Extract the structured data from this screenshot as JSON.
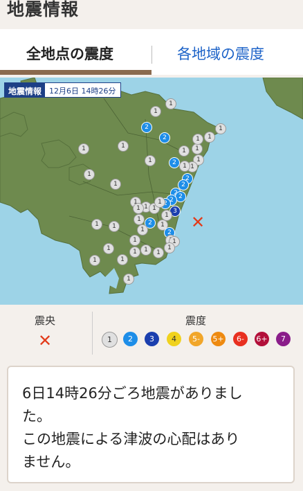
{
  "header": {
    "title": "地震情報"
  },
  "tabs": [
    {
      "label": "全地点の震度"
    },
    {
      "label": "各地域の震度"
    }
  ],
  "map": {
    "label_title": "地震情報",
    "label_time": "12月6日 14時26分"
  },
  "legend": {
    "epicenter_label": "震央",
    "epicenter_mark": "✕",
    "intensity_label": "震度",
    "scale": [
      {
        "label": "1",
        "color": "#e0e0e0"
      },
      {
        "label": "2",
        "color": "#1e8ee8"
      },
      {
        "label": "3",
        "color": "#1b3fae"
      },
      {
        "label": "4",
        "color": "#f0d21e"
      },
      {
        "label": "5-",
        "color": "#f1a62a"
      },
      {
        "label": "5+",
        "color": "#ee8a10"
      },
      {
        "label": "6-",
        "color": "#e83020"
      },
      {
        "label": "6+",
        "color": "#b2103a"
      },
      {
        "label": "7",
        "color": "#8a1d8a"
      }
    ]
  },
  "message": {
    "line1": "6日14時26分ごろ地震がありまし",
    "line2": "た。",
    "line3": "この地震による津波の心配はあり",
    "line4": "ません。"
  }
}
